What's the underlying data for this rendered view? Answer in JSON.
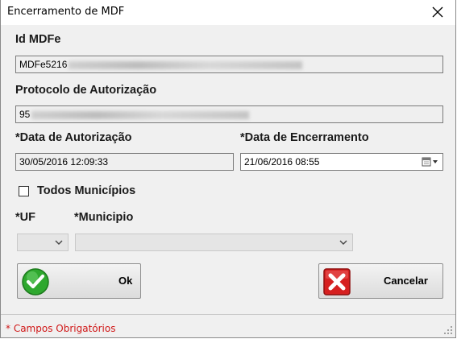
{
  "window": {
    "title": "Encerramento de MDF",
    "close_icon": "close-icon"
  },
  "form": {
    "id_mdfe": {
      "label": "Id MDFe",
      "value_visible": "MDFe5216",
      "value_redacted": true
    },
    "protocolo": {
      "label": "Protocolo de Autorização",
      "value_visible": "95",
      "value_redacted": true
    },
    "data_autorizacao": {
      "label": "*Data de Autorização",
      "value": "30/05/2016 12:09:33"
    },
    "data_encerramento": {
      "label": "*Data de Encerramento",
      "value": "21/06/2016 08:55",
      "icon": "calendar-dropdown-icon"
    },
    "todos_municipios": {
      "label": "Todos Municípios",
      "checked": false
    },
    "uf": {
      "label": "*UF",
      "value": ""
    },
    "municipio": {
      "label": "*Municipio",
      "value": ""
    }
  },
  "buttons": {
    "ok": {
      "label": "Ok",
      "icon": "green-check-icon",
      "accent": "#2fa82f"
    },
    "cancel": {
      "label": "Cancelar",
      "icon": "red-x-icon",
      "accent": "#d62020"
    }
  },
  "footer": {
    "required_note": "* Campos Obrigatórios",
    "note_color": "#d01818"
  }
}
